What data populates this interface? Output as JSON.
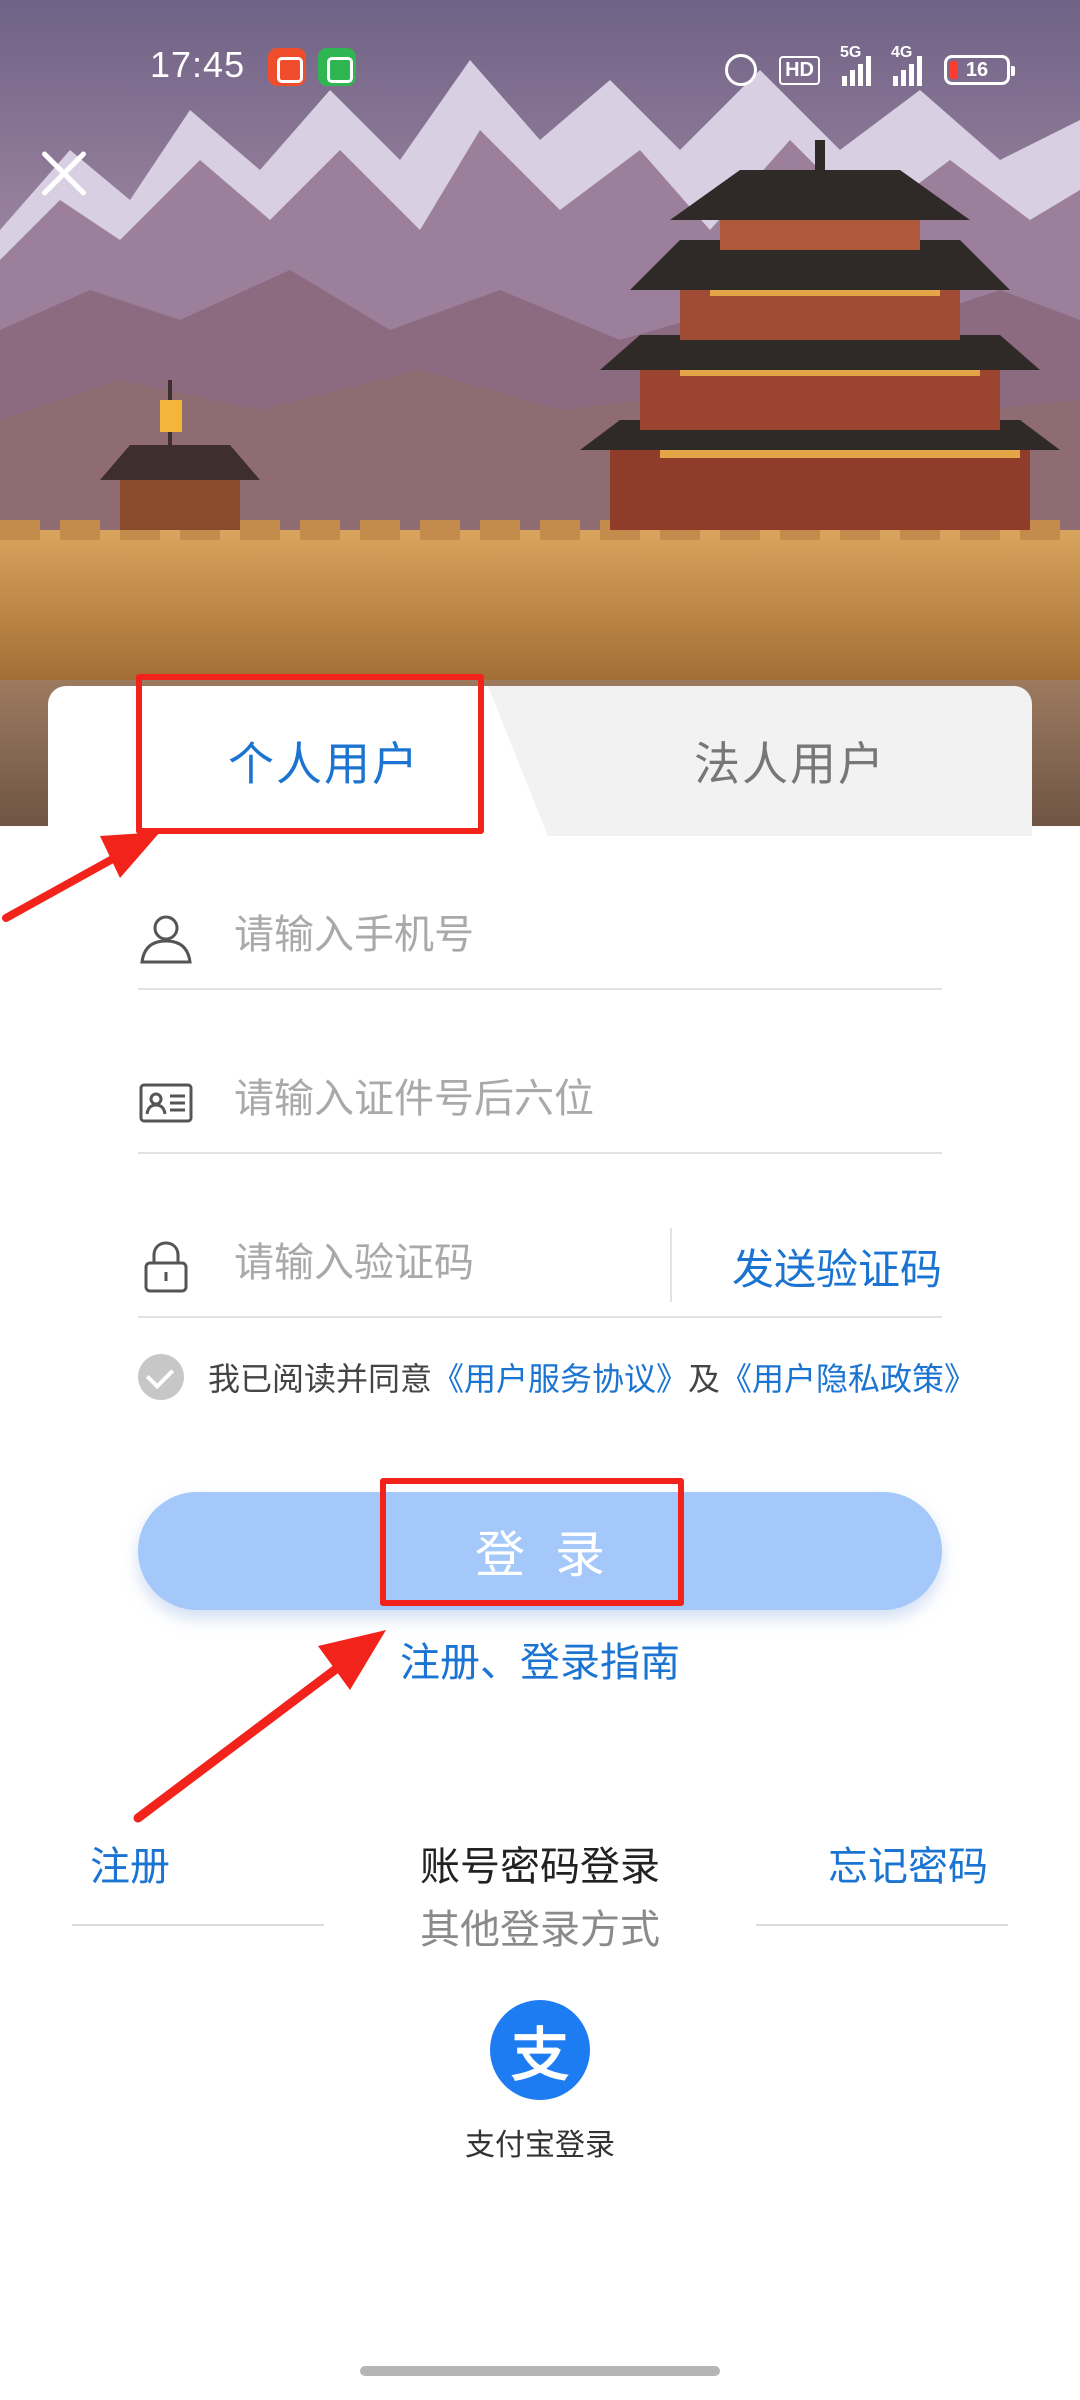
{
  "status_bar": {
    "time": "17:45",
    "hd_label": "HD",
    "network_1": "5G",
    "network_2": "4G",
    "battery": "16"
  },
  "hero": {
    "alt": "Jiayuguan pass tower with snowy mountains"
  },
  "tabs": {
    "personal": "个人用户",
    "legal": "法人用户"
  },
  "form": {
    "phone_placeholder": "请输入手机号",
    "id_placeholder": "请输入证件号后六位",
    "code_placeholder": "请输入验证码",
    "send_code": "发送验证码"
  },
  "agreement": {
    "prefix": "我已阅读并同意",
    "service_link": "《用户服务协议》",
    "conjunction": "及",
    "privacy_link": "《用户隐私政策》",
    "checked": true
  },
  "login_button": "登录",
  "guide_link": "注册、登录指南",
  "bottom": {
    "register": "注册",
    "account_login": "账号密码登录",
    "forgot": "忘记密码",
    "other_login": "其他登录方式",
    "alipay_glyph": "支",
    "alipay_label": "支付宝登录"
  },
  "colors": {
    "accent": "#1b74d1",
    "login_button": "#a3c8f9",
    "annotation": "#f2231b"
  }
}
